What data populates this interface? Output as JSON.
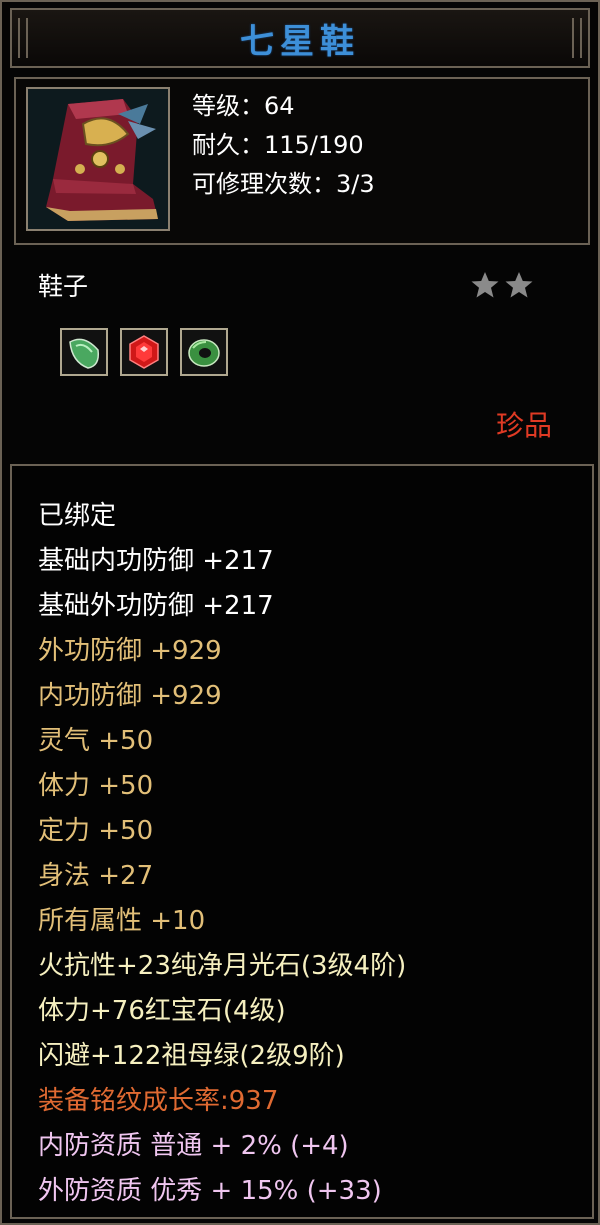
{
  "title": "七星鞋",
  "header": {
    "level_line": "等级：64",
    "durability_line": "耐久：115/190",
    "repair_line": "可修理次数：3/3"
  },
  "item_type": "鞋子",
  "stars": 2,
  "gems": [
    "green-gem-icon",
    "red-ruby-icon",
    "green-jade-icon"
  ],
  "rarity": "珍品",
  "attributes": [
    {
      "text": "已绑定",
      "color": "white"
    },
    {
      "text": "基础内功防御  +217",
      "color": "white"
    },
    {
      "text": "基础外功防御  +217",
      "color": "white"
    },
    {
      "text": "外功防御  +929",
      "color": "gold"
    },
    {
      "text": "内功防御  +929",
      "color": "gold"
    },
    {
      "text": "灵气  +50",
      "color": "gold"
    },
    {
      "text": "体力  +50",
      "color": "gold"
    },
    {
      "text": "定力  +50",
      "color": "gold"
    },
    {
      "text": "身法  +27",
      "color": "gold"
    },
    {
      "text": "所有属性  +10",
      "color": "gold"
    },
    {
      "text": "火抗性+23纯净月光石(3级4阶)",
      "color": "yellow"
    },
    {
      "text": "体力+76红宝石(4级)",
      "color": "yellow"
    },
    {
      "text": "闪避+122祖母绿(2级9阶)",
      "color": "yellow"
    },
    {
      "text": "装备铭纹成长率:937",
      "color": "orange"
    },
    {
      "text": "内防资质  普通  + 2% (+4)",
      "color": "pink"
    },
    {
      "text": "外防资质  优秀  + 15% (+33)",
      "color": "pink"
    }
  ],
  "colors": {
    "title": "#3d8fd8",
    "rarity": "#e03a24",
    "white": "#ffffff",
    "gold": "#e2bf78",
    "yellow": "#f6f0c0",
    "orange": "#e06a32",
    "pink": "#f0c6f0"
  }
}
